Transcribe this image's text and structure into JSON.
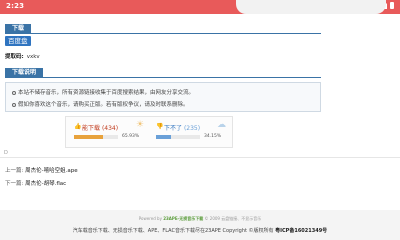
{
  "status_bar": {
    "time": "2:23",
    "accent": "#e85a5a"
  },
  "download_section": {
    "header": "下载",
    "button_label": "百度盘"
  },
  "extraction": {
    "label": "提取码:",
    "code": "vxkv"
  },
  "notes_section": {
    "header": "下载说明",
    "items": [
      "本站不储存音乐，所有资源链接收集于百度搜索结果，由网友分享交流。",
      "假如你喜欢这个音乐，请购买正版。若有版权争议，请及时联系删除。"
    ]
  },
  "votes": {
    "up": {
      "label": "能下载",
      "count": "(434)",
      "percent": "65.93%",
      "value": 0.6593,
      "color": "#e8a23c"
    },
    "down": {
      "label": "下不了",
      "count": "(235)",
      "percent": "34.15%",
      "value": 0.3415,
      "color": "#6aa0d8"
    }
  },
  "misc_letter": "D",
  "navigation": {
    "prev_label": "上一篇:",
    "prev_title": "周杰伦-嘻哈空姐.ape",
    "next_label": "下一篇:",
    "next_title": "周杰伦-胡琴.flac"
  },
  "footer": {
    "powered_prefix": "Powered by",
    "brand": "23APE-无损音乐下载",
    "powered_suffix": "© 2009 云盘链接、不显示音乐",
    "line2": "汽车载音乐下载、无损音乐下载、APE、FLAC音乐下载尽在23APE Copyright ©版权所有",
    "icp": "粤ICP备16021349号"
  }
}
